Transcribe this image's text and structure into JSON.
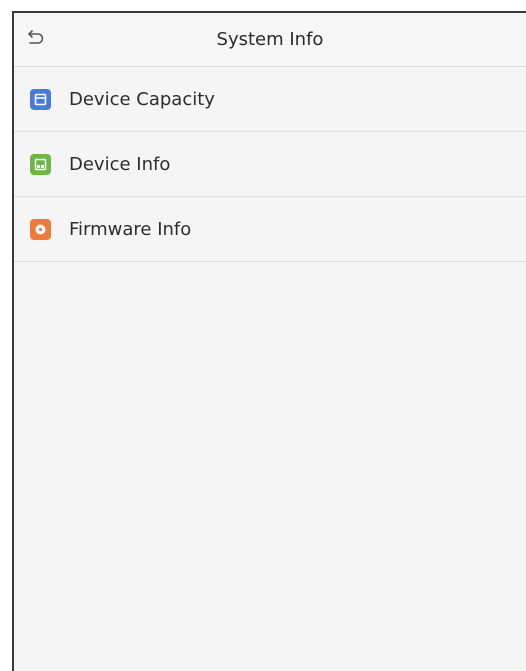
{
  "header": {
    "title": "System Info",
    "back_icon": "return-arrow-icon"
  },
  "menu": {
    "items": [
      {
        "label": "Device Capacity",
        "icon": "storage-capacity-icon",
        "icon_color": "#4a7bd8"
      },
      {
        "label": "Device Info",
        "icon": "device-info-icon",
        "icon_color": "#6cb64a"
      },
      {
        "label": "Firmware Info",
        "icon": "firmware-disc-icon",
        "icon_color": "#ee7a3d"
      }
    ]
  }
}
